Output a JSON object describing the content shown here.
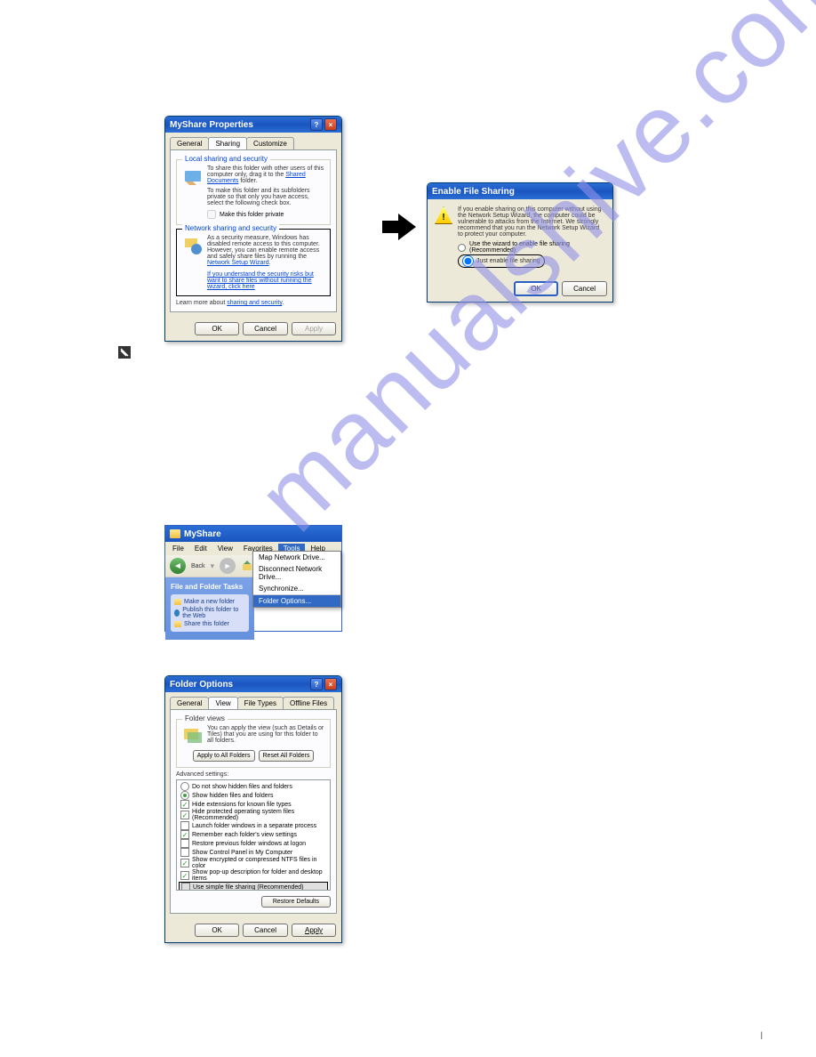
{
  "watermark": "manualshive.com",
  "win1": {
    "title": "MyShare Properties",
    "tabs": {
      "t0": "General",
      "t1": "Sharing",
      "t2": "Customize"
    },
    "group1": {
      "title": "Local sharing and security",
      "text1": "To share this folder with other users of this computer only, drag it to the ",
      "link1": "Shared Documents",
      "text1b": " folder.",
      "text2": "To make this folder and its subfolders private so that only you have access, select the following check box.",
      "check1": "Make this folder private"
    },
    "group2": {
      "title": "Network sharing and security",
      "text1": "As a security measure, Windows has disabled remote access to this computer. However, you can enable remote access and safely share files by running the ",
      "link1": "Network Setup Wizard",
      "link2": "If you understand the security risks but want to share files without running the wizard, click here"
    },
    "learn_prefix": "Learn more about ",
    "learn_link": "sharing and security",
    "btn_ok": "OK",
    "btn_cancel": "Cancel",
    "btn_apply": "Apply"
  },
  "win2": {
    "title": "Enable File Sharing",
    "text": "If you enable sharing on this computer without using the Network Setup Wizard, the computer could be vulnerable to attacks from the Internet. We strongly recommend that you run the Network Setup Wizard to protect your computer.",
    "radio1": "Use the wizard to enable file sharing (Recommended)",
    "radio2": "Just enable file sharing",
    "btn_ok": "OK",
    "btn_cancel": "Cancel"
  },
  "explorer": {
    "title": "MyShare",
    "menu": {
      "m0": "File",
      "m1": "Edit",
      "m2": "View",
      "m3": "Favorites",
      "m4": "Tools",
      "m5": "Help"
    },
    "back": "Back",
    "dropdown": {
      "d0": "Map Network Drive...",
      "d1": "Disconnect Network Drive...",
      "d2": "Synchronize...",
      "d3": "Folder Options..."
    },
    "side_title": "File and Folder Tasks",
    "side": {
      "s0": "Make a new folder",
      "s1": "Publish this folder to the Web",
      "s2": "Share this folder"
    }
  },
  "win3": {
    "title": "Folder Options",
    "tabs": {
      "t0": "General",
      "t1": "View",
      "t2": "File Types",
      "t3": "Offline Files"
    },
    "fv_title": "Folder views",
    "fv_text": "You can apply the view (such as Details or Tiles) that you are using for this folder to all folders.",
    "btn_apply_all": "Apply to All Folders",
    "btn_reset_all": "Reset All Folders",
    "adv_title": "Advanced settings:",
    "adv": {
      "a0": "Do not show hidden files and folders",
      "a1": "Show hidden files and folders",
      "a2": "Hide extensions for known file types",
      "a3": "Hide protected operating system files (Recommended)",
      "a4": "Launch folder windows in a separate process",
      "a5": "Remember each folder's view settings",
      "a6": "Restore previous folder windows at logon",
      "a7": "Show Control Panel in My Computer",
      "a8": "Show encrypted or compressed NTFS files in color",
      "a9": "Show pop-up description for folder and desktop items",
      "a10": "Use simple file sharing (Recommended)"
    },
    "btn_restore": "Restore Defaults",
    "btn_ok": "OK",
    "btn_cancel": "Cancel",
    "btn_apply": "Apply"
  },
  "footer": {
    "separator": "|"
  }
}
